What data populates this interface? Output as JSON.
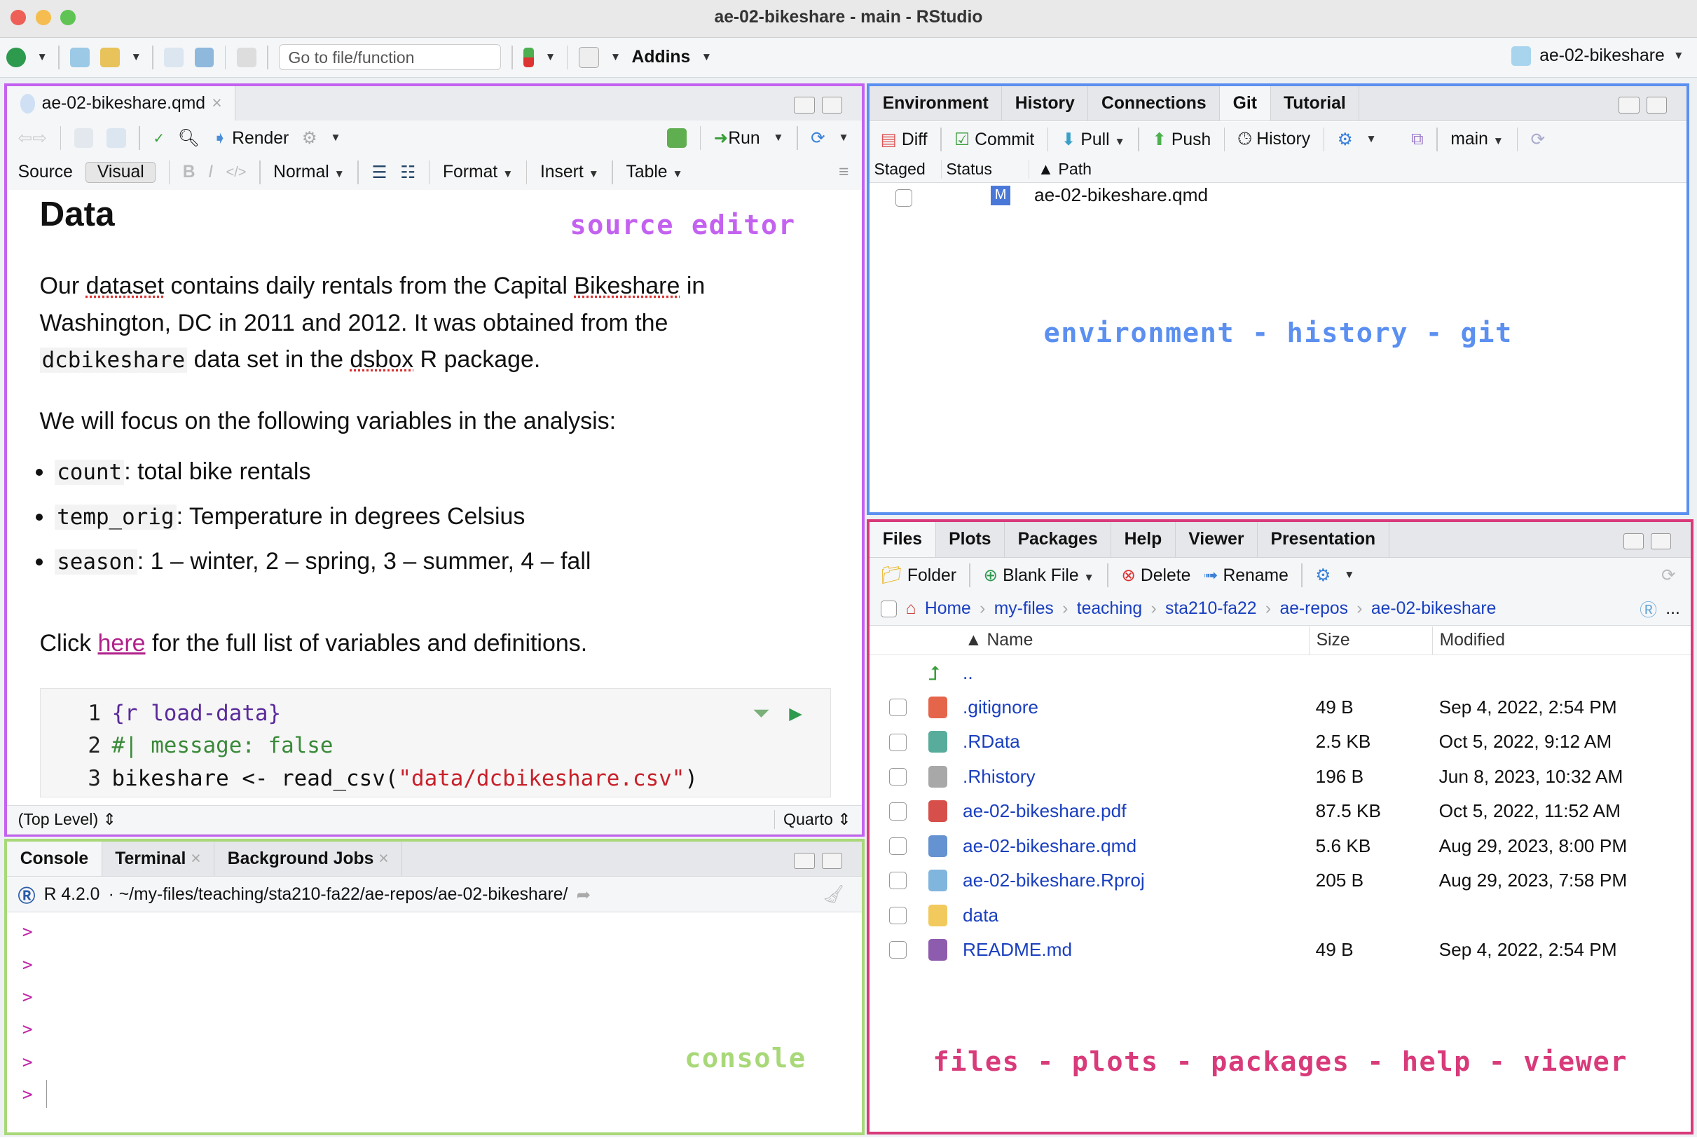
{
  "window": {
    "title": "ae-02-bikeshare - main - RStudio"
  },
  "toolbar": {
    "goto_placeholder": "Go to file/function",
    "addins": "Addins",
    "project": "ae-02-bikeshare"
  },
  "source": {
    "tab": "ae-02-bikeshare.qmd",
    "close": "×",
    "render": "Render",
    "run": "Run",
    "source_mode": "Source",
    "visual_mode": "Visual",
    "bold": "B",
    "italic": "I",
    "code": "</>",
    "style": "Normal",
    "format": "Format",
    "insert": "Insert",
    "table": "Table",
    "annotation": "source editor",
    "heading": "Data",
    "p1_a": "Our ",
    "p1_link1": "dataset",
    "p1_b": " contains daily rentals from the Capital ",
    "p1_link2": "Bikeshare",
    "p1_c": " in Washington, DC in 2011 and 2012. It was obtained from the ",
    "p1_code": "dcbikeshare",
    "p1_d": " data set in the ",
    "p1_link3": "dsbox",
    "p1_e": " R package.",
    "p2": "We will focus on the following variables in the analysis:",
    "bullets": [
      {
        "code": "count",
        "text": ": total bike rentals"
      },
      {
        "code": "temp_orig",
        "text": ": Temperature in degrees Celsius"
      },
      {
        "code": "season",
        "text": ": 1 – winter, 2 – spring, 3 – summer, 4 – fall"
      }
    ],
    "p3_a": "Click ",
    "p3_link": "here",
    "p3_b": " for the full list of variables and definitions.",
    "chunk": [
      {
        "n": "1",
        "text": "{r load-data}"
      },
      {
        "n": "2",
        "text": "#| message: false"
      },
      {
        "n": "3",
        "pre": "bikeshare <- read_csv(",
        "str": "\"data/dcbikeshare.csv\"",
        "post": ")"
      }
    ],
    "status_left": "(Top Level) ⇕",
    "status_right": "Quarto ⇕"
  },
  "console": {
    "tabs": [
      "Console",
      "Terminal",
      "Background Jobs"
    ],
    "version": "R 4.2.0",
    "path": "· ~/my-files/teaching/sta210-fa22/ae-repos/ae-02-bikeshare/",
    "prompts": [
      ">",
      ">",
      ">",
      ">",
      ">",
      ">"
    ],
    "annotation": "console"
  },
  "envpane": {
    "tabs": [
      "Environment",
      "History",
      "Connections",
      "Git",
      "Tutorial"
    ],
    "active_tab": "Git",
    "tools": {
      "diff": "Diff",
      "commit": "Commit",
      "pull": "Pull",
      "push": "Push",
      "history": "History",
      "branch": "main"
    },
    "columns": [
      "Staged",
      "Status",
      "▲ Path"
    ],
    "rows": [
      {
        "status": "M",
        "path": "ae-02-bikeshare.qmd"
      }
    ],
    "annotation": "environment - history - git"
  },
  "filespane": {
    "tabs": [
      "Files",
      "Plots",
      "Packages",
      "Help",
      "Viewer",
      "Presentation"
    ],
    "active_tab": "Files",
    "tools": {
      "folder": "Folder",
      "blank_file": "Blank File",
      "delete": "Delete",
      "rename": "Rename"
    },
    "breadcrumb": [
      "Home",
      "my-files",
      "teaching",
      "sta210-fa22",
      "ae-repos",
      "ae-02-bikeshare"
    ],
    "more": "...",
    "columns": [
      "▲ Name",
      "Size",
      "Modified"
    ],
    "parent": "..",
    "files": [
      {
        "name": ".gitignore",
        "size": "49 B",
        "modified": "Sep 4, 2022, 2:54 PM",
        "icon": "git-icon",
        "color": "#e04a2a"
      },
      {
        "name": ".RData",
        "size": "2.5 KB",
        "modified": "Oct 5, 2022, 9:12 AM",
        "icon": "rdata-icon",
        "color": "#3a9e8a"
      },
      {
        "name": ".Rhistory",
        "size": "196 B",
        "modified": "Jun 8, 2023, 10:32 AM",
        "icon": "clock-icon",
        "color": "#999999"
      },
      {
        "name": "ae-02-bikeshare.pdf",
        "size": "87.5 KB",
        "modified": "Oct 5, 2022, 11:52 AM",
        "icon": "pdf-icon",
        "color": "#d0302a"
      },
      {
        "name": "ae-02-bikeshare.qmd",
        "size": "5.6 KB",
        "modified": "Aug 29, 2023, 8:00 PM",
        "icon": "quarto-icon",
        "color": "#4a7fc8"
      },
      {
        "name": "ae-02-bikeshare.Rproj",
        "size": "205 B",
        "modified": "Aug 29, 2023, 7:58 PM",
        "icon": "rproj-icon",
        "color": "#6aa8d8"
      },
      {
        "name": "data",
        "size": "",
        "modified": "",
        "icon": "folder-icon",
        "color": "#f0c040"
      },
      {
        "name": "README.md",
        "size": "49 B",
        "modified": "Sep 4, 2022, 2:54 PM",
        "icon": "markdown-icon",
        "color": "#7a3fa0"
      }
    ],
    "annotation": "files - plots - packages - help - viewer"
  },
  "colors": {
    "source_border": "#c462f0",
    "console_border": "#a8d878",
    "env_border": "#5b8ff0",
    "files_border": "#d83a7a"
  }
}
